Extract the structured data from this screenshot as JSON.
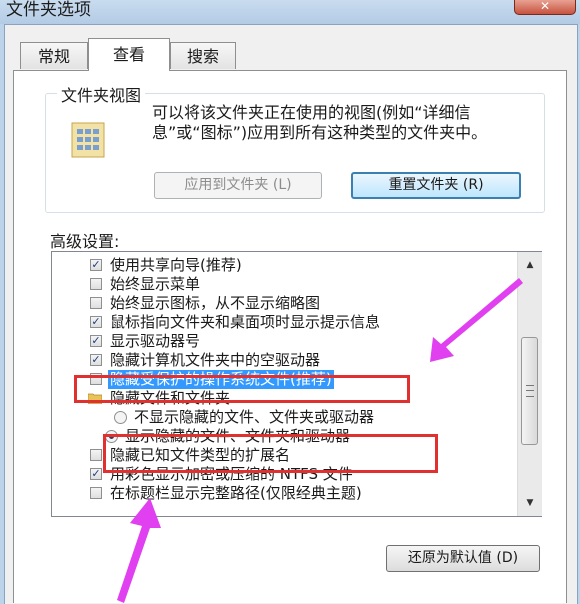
{
  "window": {
    "title": "文件夹选项",
    "close_glyph": "✕"
  },
  "tabs": [
    {
      "label": "常规",
      "active": false
    },
    {
      "label": "查看",
      "active": true
    },
    {
      "label": "搜索",
      "active": false
    }
  ],
  "folder_view": {
    "label": "文件夹视图",
    "description": "可以将该文件夹正在使用的视图(例如“详细信息”或“图标”)应用到所有这种类型的文件夹中。",
    "apply_button": "应用到文件夹 (L)",
    "reset_button": "重置文件夹 (R)"
  },
  "advanced": {
    "label": "高级设置:",
    "items": [
      {
        "type": "checkbox",
        "checked": true,
        "label": "使用共享向导(推荐)"
      },
      {
        "type": "checkbox",
        "checked": false,
        "label": "始终显示菜单"
      },
      {
        "type": "checkbox",
        "checked": false,
        "label": "始终显示图标，从不显示缩略图"
      },
      {
        "type": "checkbox",
        "checked": true,
        "label": "鼠标指向文件夹和桌面项时显示提示信息"
      },
      {
        "type": "checkbox",
        "checked": true,
        "label": "显示驱动器号"
      },
      {
        "type": "checkbox",
        "checked": true,
        "label": "隐藏计算机文件夹中的空驱动器"
      },
      {
        "type": "checkbox",
        "checked": false,
        "label": "隐藏受保护的操作系统文件(推荐)",
        "selected": true
      },
      {
        "type": "folder",
        "label": "隐藏文件和文件夹"
      },
      {
        "type": "radio",
        "checked": false,
        "label": "不显示隐藏的文件、文件夹或驱动器"
      },
      {
        "type": "radio",
        "checked": true,
        "label": "显示隐藏的文件、文件夹和驱动器"
      },
      {
        "type": "checkbox",
        "checked": false,
        "label": "隐藏已知文件类型的扩展名"
      },
      {
        "type": "checkbox",
        "checked": true,
        "label": "用彩色显示加密或压缩的 NTFS 文件"
      },
      {
        "type": "checkbox",
        "checked": false,
        "label": "在标题栏显示完整路径(仅限经典主题)"
      }
    ],
    "restore_button": "还原为默认值 (D)",
    "scroll_up_glyph": "▲",
    "scroll_down_glyph": "▼"
  },
  "annotation": {
    "box_color": "#e03030",
    "arrow_color": "#e040f0"
  },
  "icons": {
    "folder_view": "folder-view-icon",
    "folder": "folder-icon"
  }
}
